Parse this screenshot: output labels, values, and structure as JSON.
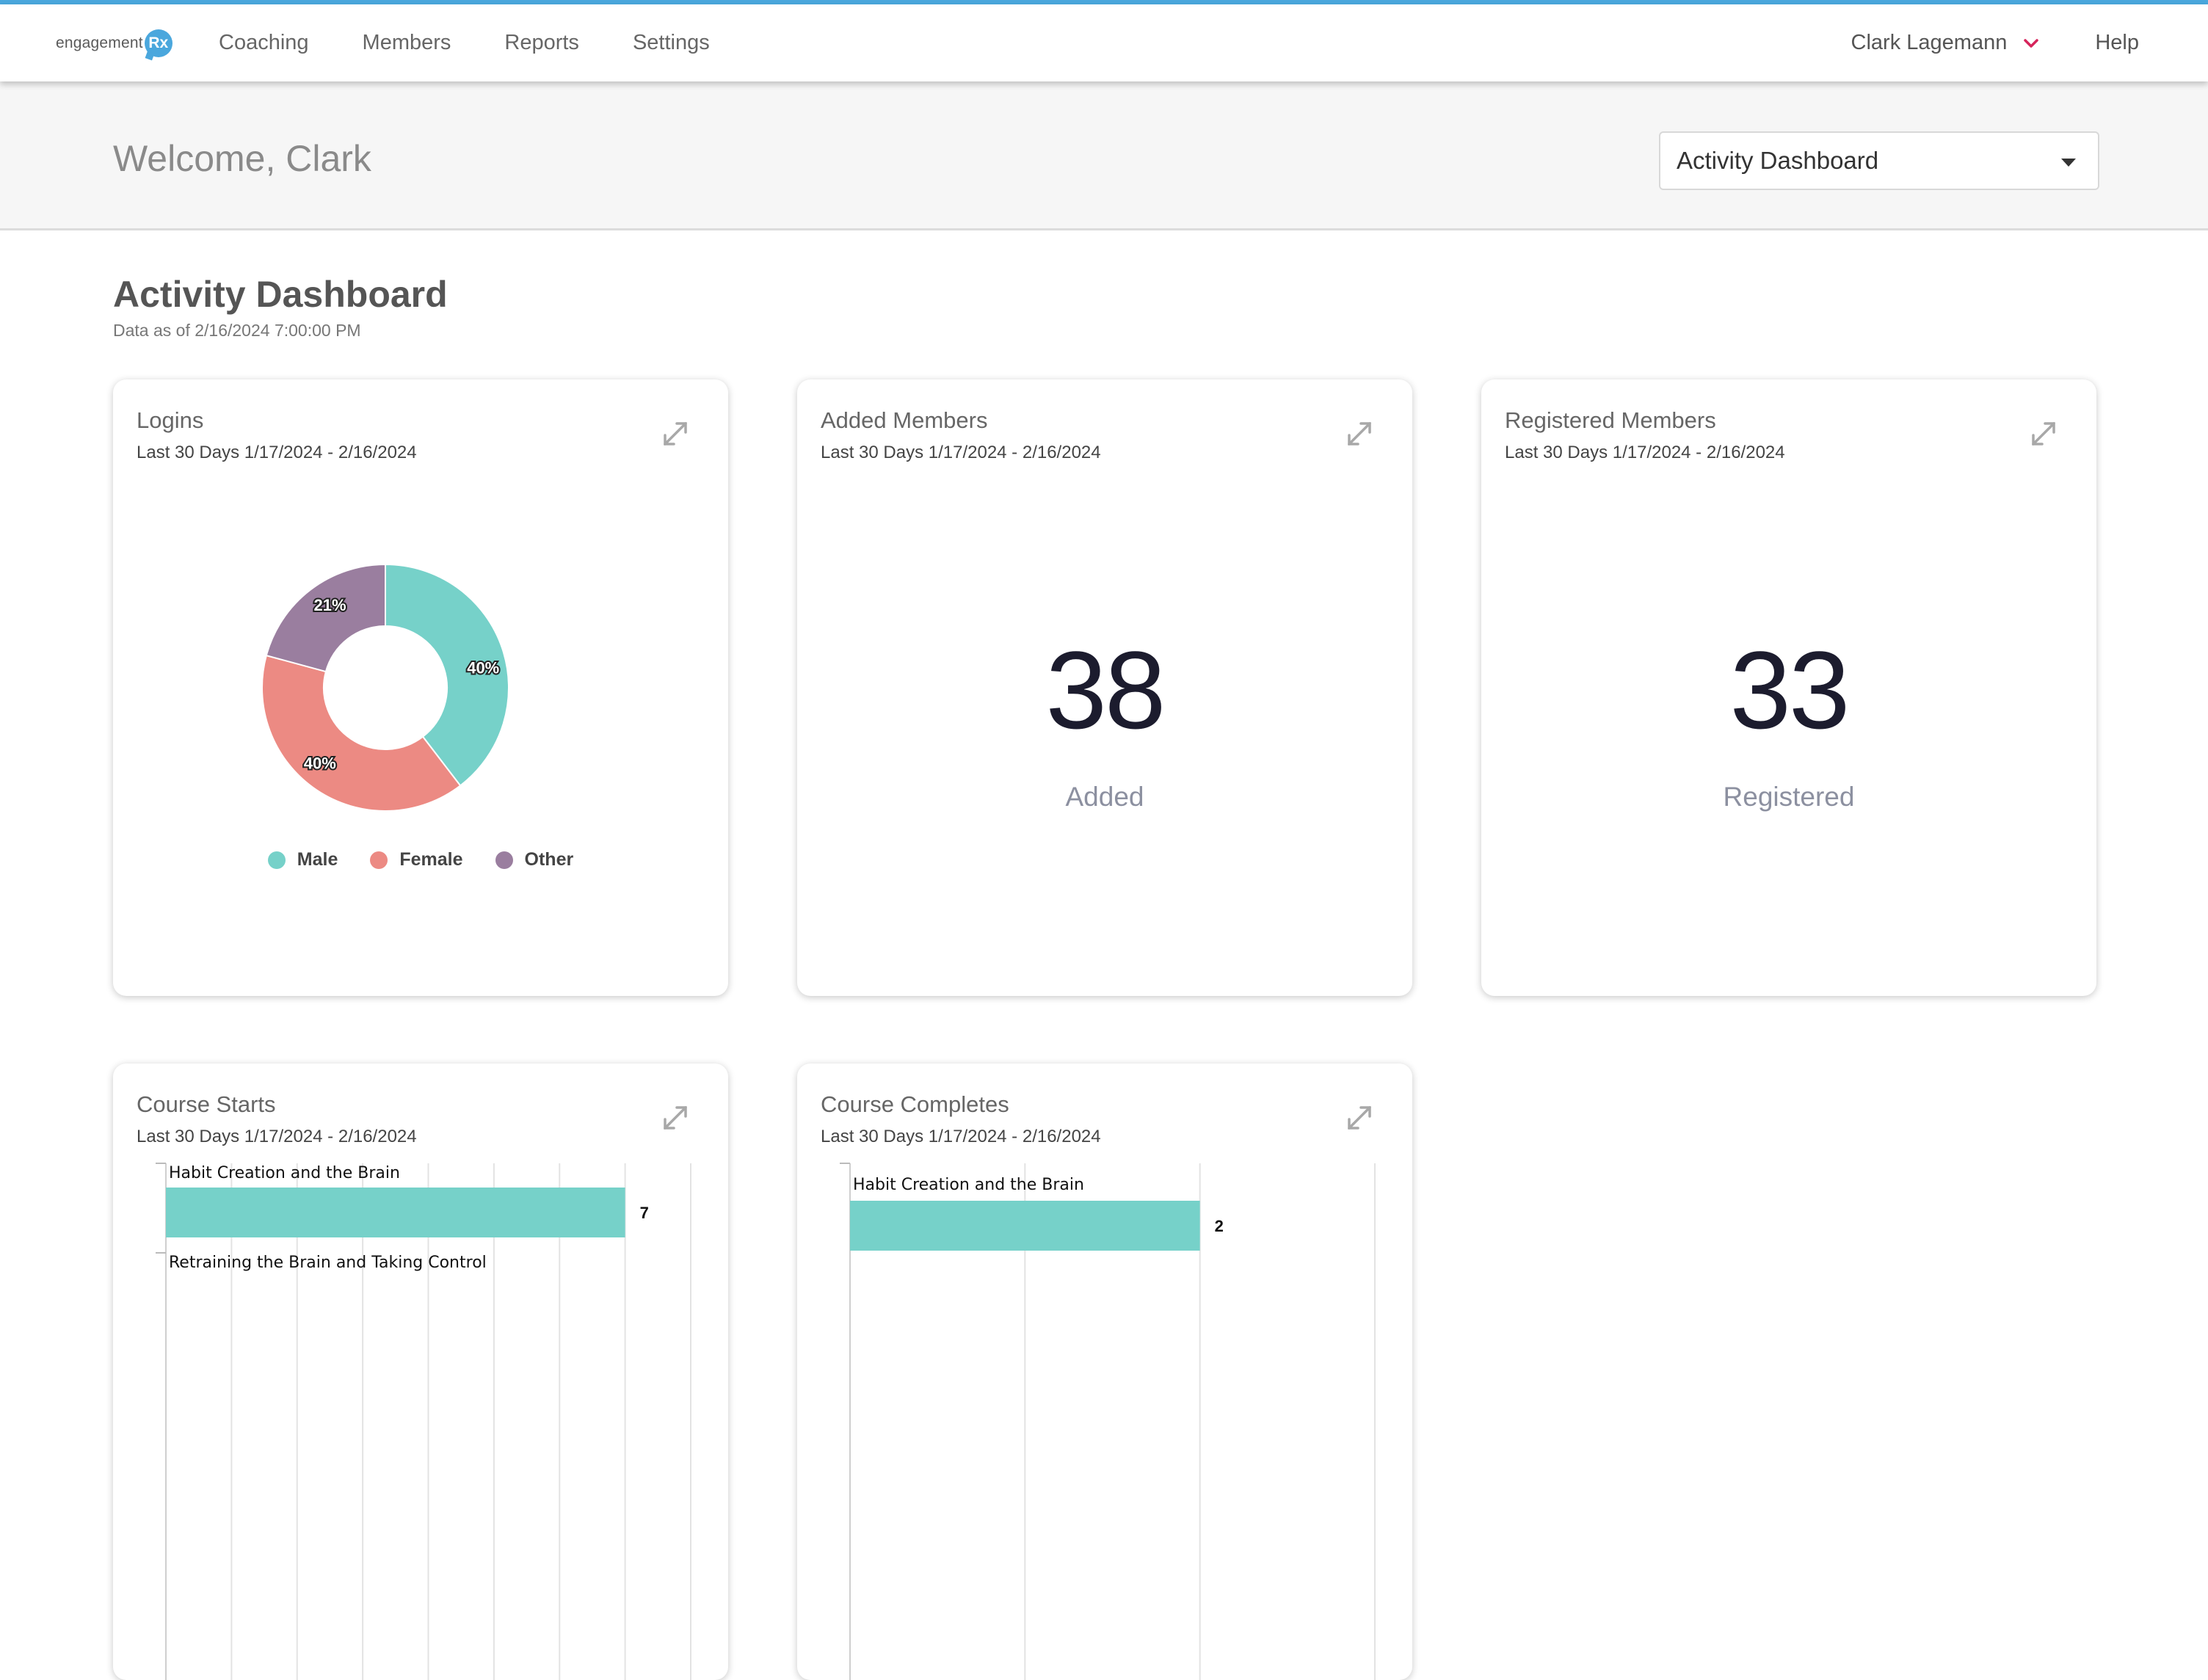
{
  "brand": {
    "logo_text": "engagement",
    "logo_badge": "Rx",
    "accent": "#4aa7dd"
  },
  "nav": {
    "links": [
      "Coaching",
      "Members",
      "Reports",
      "Settings"
    ],
    "user_name": "Clark Lagemann",
    "help": "Help"
  },
  "welcome": {
    "greeting": "Welcome, Clark",
    "dashboard_select": "Activity Dashboard"
  },
  "page": {
    "title": "Activity Dashboard",
    "data_as_of": "Data as of 2/16/2024 7:00:00 PM"
  },
  "cards": {
    "logins": {
      "title": "Logins",
      "subtitle": "Last 30 Days 1/17/2024 - 2/16/2024"
    },
    "added": {
      "title": "Added Members",
      "subtitle": "Last 30 Days 1/17/2024 - 2/16/2024",
      "value": "38",
      "label": "Added"
    },
    "registered": {
      "title": "Registered Members",
      "subtitle": "Last 30 Days 1/17/2024 - 2/16/2024",
      "value": "33",
      "label": "Registered"
    },
    "course_starts": {
      "title": "Course Starts",
      "subtitle": "Last 30 Days 1/17/2024 - 2/16/2024"
    },
    "course_completes": {
      "title": "Course Completes",
      "subtitle": "Last 30 Days 1/17/2024 - 2/16/2024"
    }
  },
  "chart_data": [
    {
      "type": "pie",
      "title": "Logins",
      "categories": [
        "Male",
        "Female",
        "Other"
      ],
      "values": [
        40,
        40,
        21
      ],
      "data_labels": [
        "40%",
        "40%",
        "21%"
      ],
      "colors": [
        "#76d1c9",
        "#ec8a83",
        "#9a7e9f"
      ],
      "legend": "bottom"
    },
    {
      "type": "bar",
      "orientation": "horizontal",
      "title": "Course Starts",
      "categories": [
        "Habit Creation and the Brain",
        "Retraining the Brain and Taking Control"
      ],
      "values": [
        7,
        null
      ],
      "data_labels": [
        "7"
      ],
      "colors": [
        "#76d1c9"
      ],
      "xlim": [
        0,
        8
      ]
    },
    {
      "type": "bar",
      "orientation": "horizontal",
      "title": "Course Completes",
      "categories": [
        "Habit Creation and the Brain"
      ],
      "values": [
        2
      ],
      "data_labels": [
        "2"
      ],
      "colors": [
        "#76d1c9"
      ],
      "xlim": [
        0,
        3
      ]
    }
  ]
}
